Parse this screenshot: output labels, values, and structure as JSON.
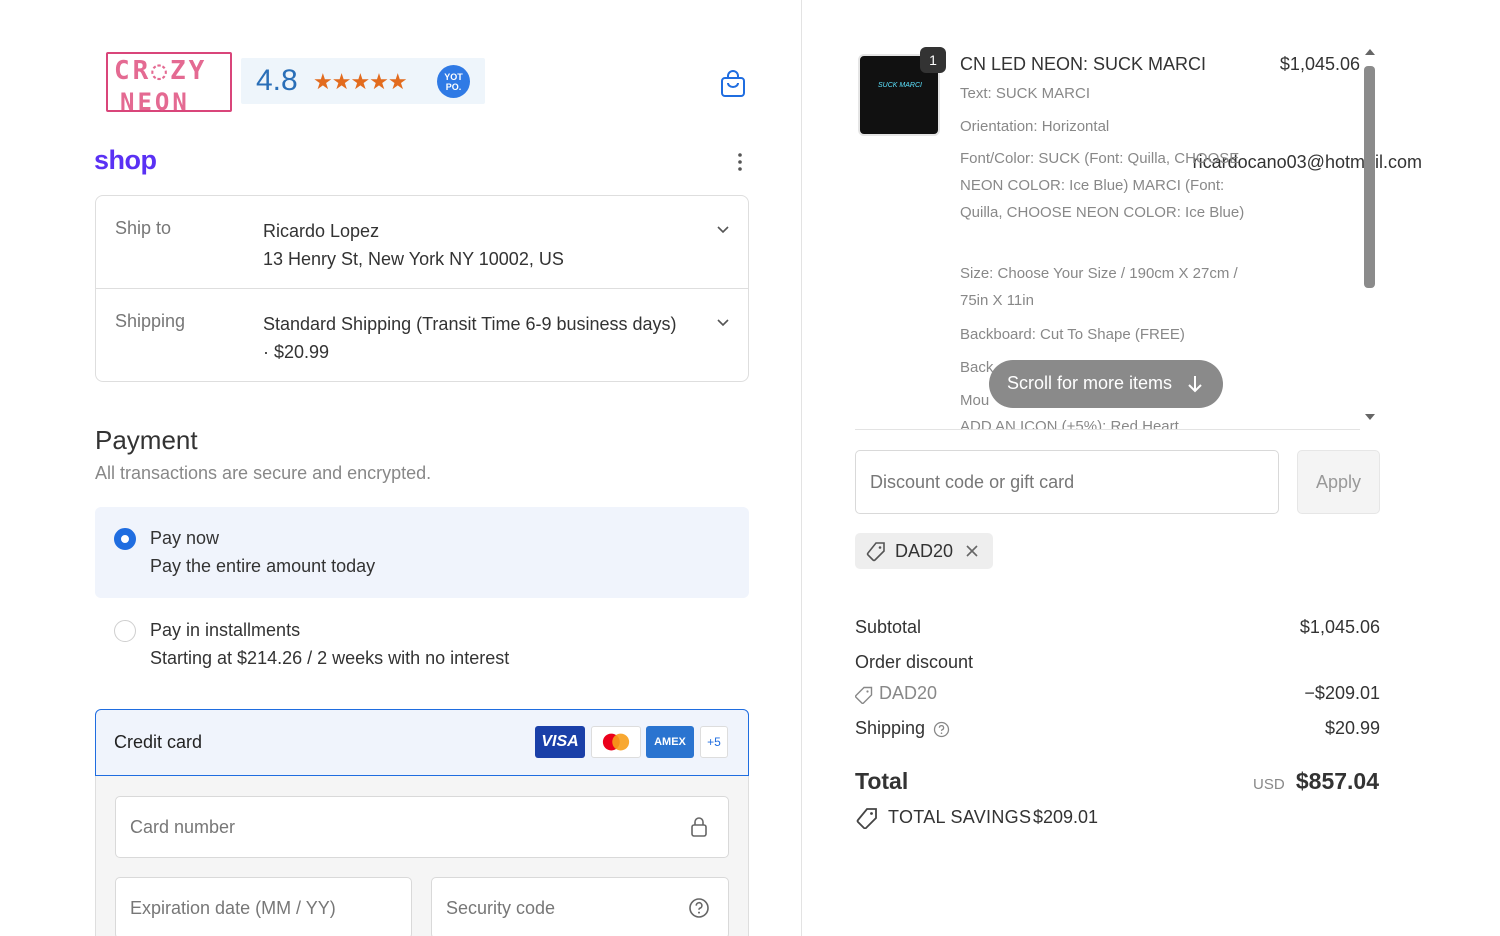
{
  "header": {
    "logo_line1": "CR◌ZY",
    "logo_line2": "NEON",
    "rating": "4.8",
    "stars": "★★★★★",
    "yotpo_badge": "YOT PO.",
    "shop_brand": "shop",
    "email": "ricardocano03@hotmail.com"
  },
  "ship": {
    "ship_to_label": "Ship to",
    "ship_to_name": "Ricardo Lopez",
    "ship_to_address": "13 Henry St, New York NY 10002, US",
    "shipping_label": "Shipping",
    "shipping_value": "Standard Shipping (Transit Time 6-9 business days) · $20.99"
  },
  "payment": {
    "title": "Payment",
    "subtitle": "All transactions are secure and encrypted.",
    "option_now_title": "Pay now",
    "option_now_sub": "Pay the entire amount today",
    "option_inst_title": "Pay in installments",
    "option_inst_sub": "Starting at $214.26 / 2 weeks with no interest",
    "credit_card_label": "Credit card",
    "card_brands": {
      "visa": "VISA",
      "amex": "AMEX",
      "more": "+5"
    },
    "card_number_placeholder": "Card number",
    "expiration_placeholder": "Expiration date (MM / YY)",
    "security_placeholder": "Security code"
  },
  "order": {
    "quantity": "1",
    "thumb_text": "SUCK MARCI",
    "title": "CN LED NEON: SUCK MARCI",
    "price": "$1,045.06",
    "attributes": [
      "Text: SUCK MARCI",
      "Orientation: Horizontal",
      "Font/Color: SUCK (Font: Quilla, CHOOSE NEON COLOR: Ice Blue) MARCI (Font: Quilla, CHOOSE NEON COLOR: Ice Blue)",
      "Size: Choose Your Size / 190cm X 27cm / 75in X 11in",
      "Backboard: Cut To Shape (FREE)",
      "Back",
      "Mou",
      "ADD AN ICON (+5%): Red Heart"
    ],
    "scroll_hint": "Scroll for more items"
  },
  "discount": {
    "placeholder": "Discount code or gift card",
    "apply_label": "Apply",
    "applied_code": "DAD20"
  },
  "summary": {
    "subtotal_label": "Subtotal",
    "subtotal_value": "$1,045.06",
    "order_discount_label": "Order discount",
    "discount_code": "DAD20",
    "discount_value": "−$209.01",
    "shipping_label": "Shipping",
    "shipping_value": "$20.99",
    "total_label": "Total",
    "currency": "USD",
    "total_value": "$857.04",
    "savings_label": "TOTAL SAVINGS",
    "savings_value": "$209.01"
  },
  "colors": {
    "accent": "#1f6de0",
    "shop_purple": "#5a31f4",
    "logo_pink": "#e46a92"
  }
}
